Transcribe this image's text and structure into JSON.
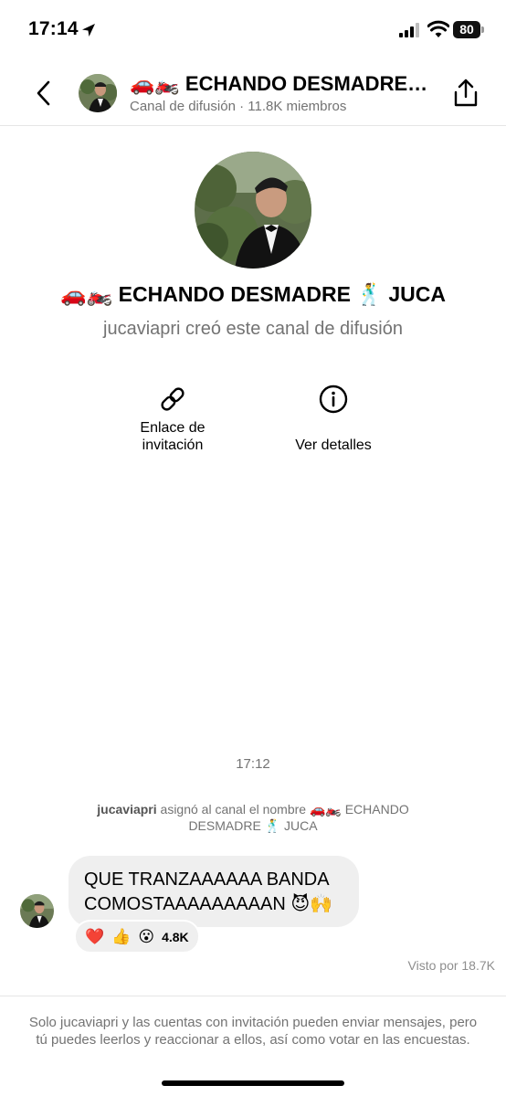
{
  "status_bar": {
    "time": "17:14",
    "battery": "80"
  },
  "header": {
    "title": "🚗🏍️ ECHANDO DESMADRE…",
    "subtitle": "Canal de difusión · 11.8K miembros"
  },
  "channel": {
    "title": "🚗🏍️ ECHANDO DESMADRE 🕺 JUCA",
    "creator_line": "jucaviapri creó este canal de difusión"
  },
  "actions": {
    "invite_label_line1": "Enlace de",
    "invite_label_line2": "invitación",
    "details_label": "Ver detalles"
  },
  "chat": {
    "time": "17:12",
    "system_user": "jucaviapri",
    "system_text_line1": " asignó al canal el nombre 🚗🏍️ ECHANDO",
    "system_text_line2": "DESMADRE 🕺 JUCA",
    "message_line1": "QUE TRANZAAAAAA BANDA",
    "message_line2": "COMOSTAAAAAAAAAN 😈🙌",
    "reactions": [
      "❤️",
      "👍",
      "😮"
    ],
    "reaction_count": "4.8K",
    "seen_by": "Visto por 18.7K"
  },
  "footer": {
    "note": "Solo jucaviapri y las cuentas con invitación pueden enviar mensajes, pero tú puedes leerlos y reaccionar a ellos, así como votar en las encuestas."
  },
  "icons": [
    "location-arrow-icon",
    "signal-icon",
    "wifi-icon",
    "battery-icon",
    "back-chevron-icon",
    "share-icon",
    "link-icon",
    "info-icon"
  ]
}
